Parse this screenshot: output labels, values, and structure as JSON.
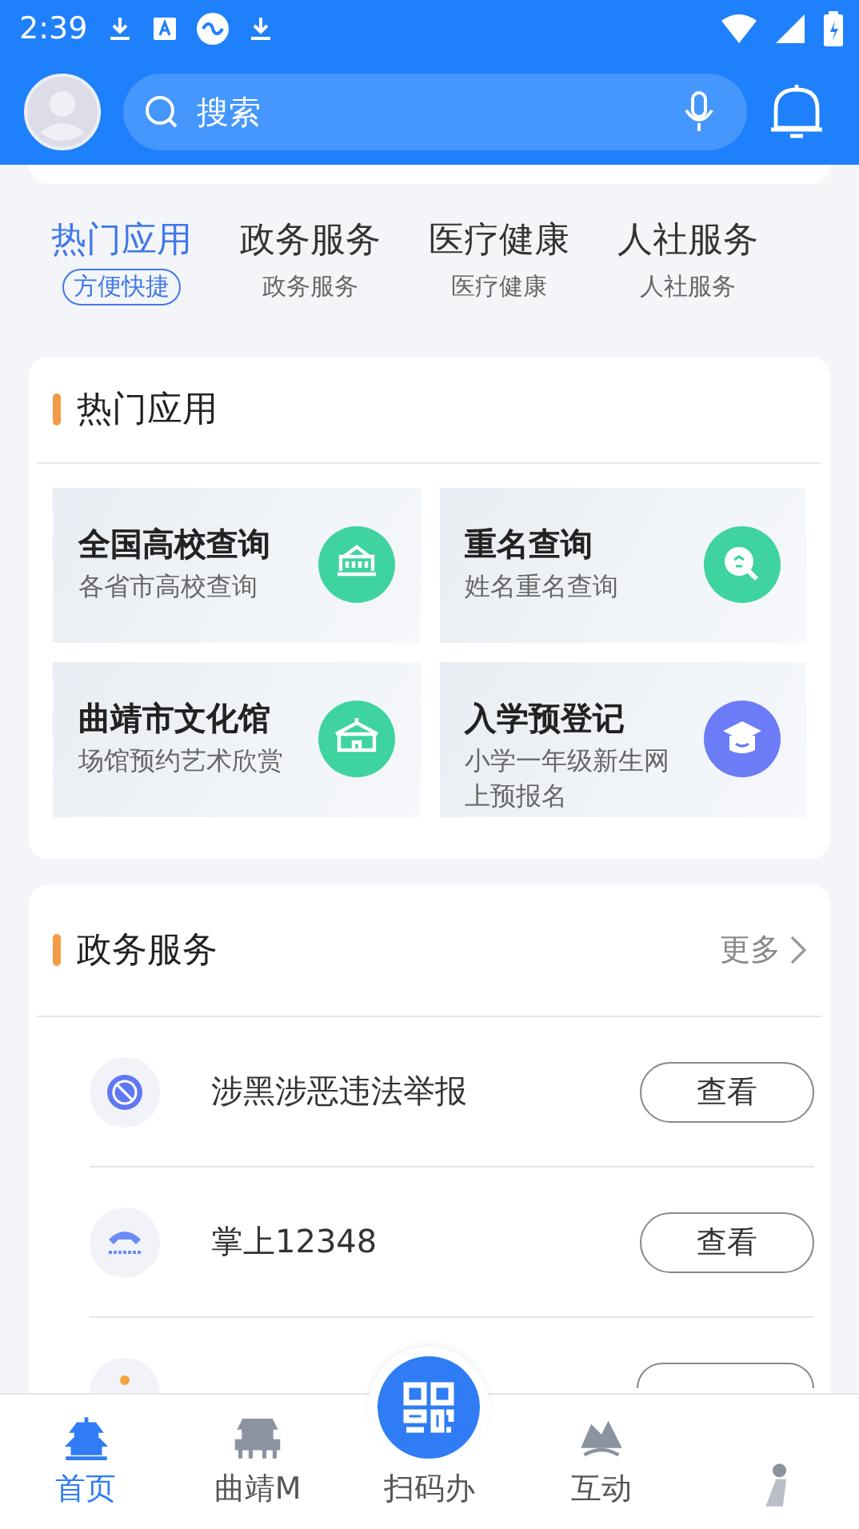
{
  "status_bar": {
    "time": "2:39"
  },
  "header": {
    "search": {
      "placeholder": "搜索"
    }
  },
  "category_tabs": [
    {
      "label": "热门应用",
      "sublabel": "方便快捷",
      "selected": true
    },
    {
      "label": "政务服务",
      "sublabel": "政务服务",
      "selected": false
    },
    {
      "label": "医疗健康",
      "sublabel": "医疗健康",
      "selected": false
    },
    {
      "label": "人社服务",
      "sublabel": "人社服务",
      "selected": false
    }
  ],
  "hot_apps": {
    "title": "热门应用",
    "items": [
      {
        "title": "全国高校查询",
        "subtitle": "各省市高校查询",
        "kind": "college",
        "color": "#3fd3a0"
      },
      {
        "title": "重名查询",
        "subtitle": "姓名重名查询",
        "kind": "name",
        "color": "#3fd3a0"
      },
      {
        "title": "曲靖市文化馆",
        "subtitle": "场馆预约艺术欣赏",
        "kind": "museum",
        "color": "#3fd3a0"
      },
      {
        "title": "入学预登记",
        "subtitle": "小学一年级新生网上预报名",
        "kind": "cap",
        "color": "#6b7cf6"
      }
    ]
  },
  "gov_services": {
    "title": "政务服务",
    "more": "更多",
    "rows": [
      {
        "label": "涉黑涉恶违法举报",
        "button": "查看",
        "kind": "report"
      },
      {
        "label": "掌上12348",
        "button": "查看",
        "kind": "phone"
      },
      {
        "kind": "partial"
      }
    ]
  },
  "bottom_nav": {
    "center": {
      "label": "扫码办"
    },
    "items": [
      {
        "label": "首页",
        "selected": true,
        "kind": "pagoda"
      },
      {
        "label": "曲靖M",
        "selected": false,
        "kind": "gate"
      },
      {
        "label": "互动",
        "selected": false,
        "kind": "hill"
      },
      {
        "selected": false,
        "kind": "figure"
      }
    ]
  }
}
